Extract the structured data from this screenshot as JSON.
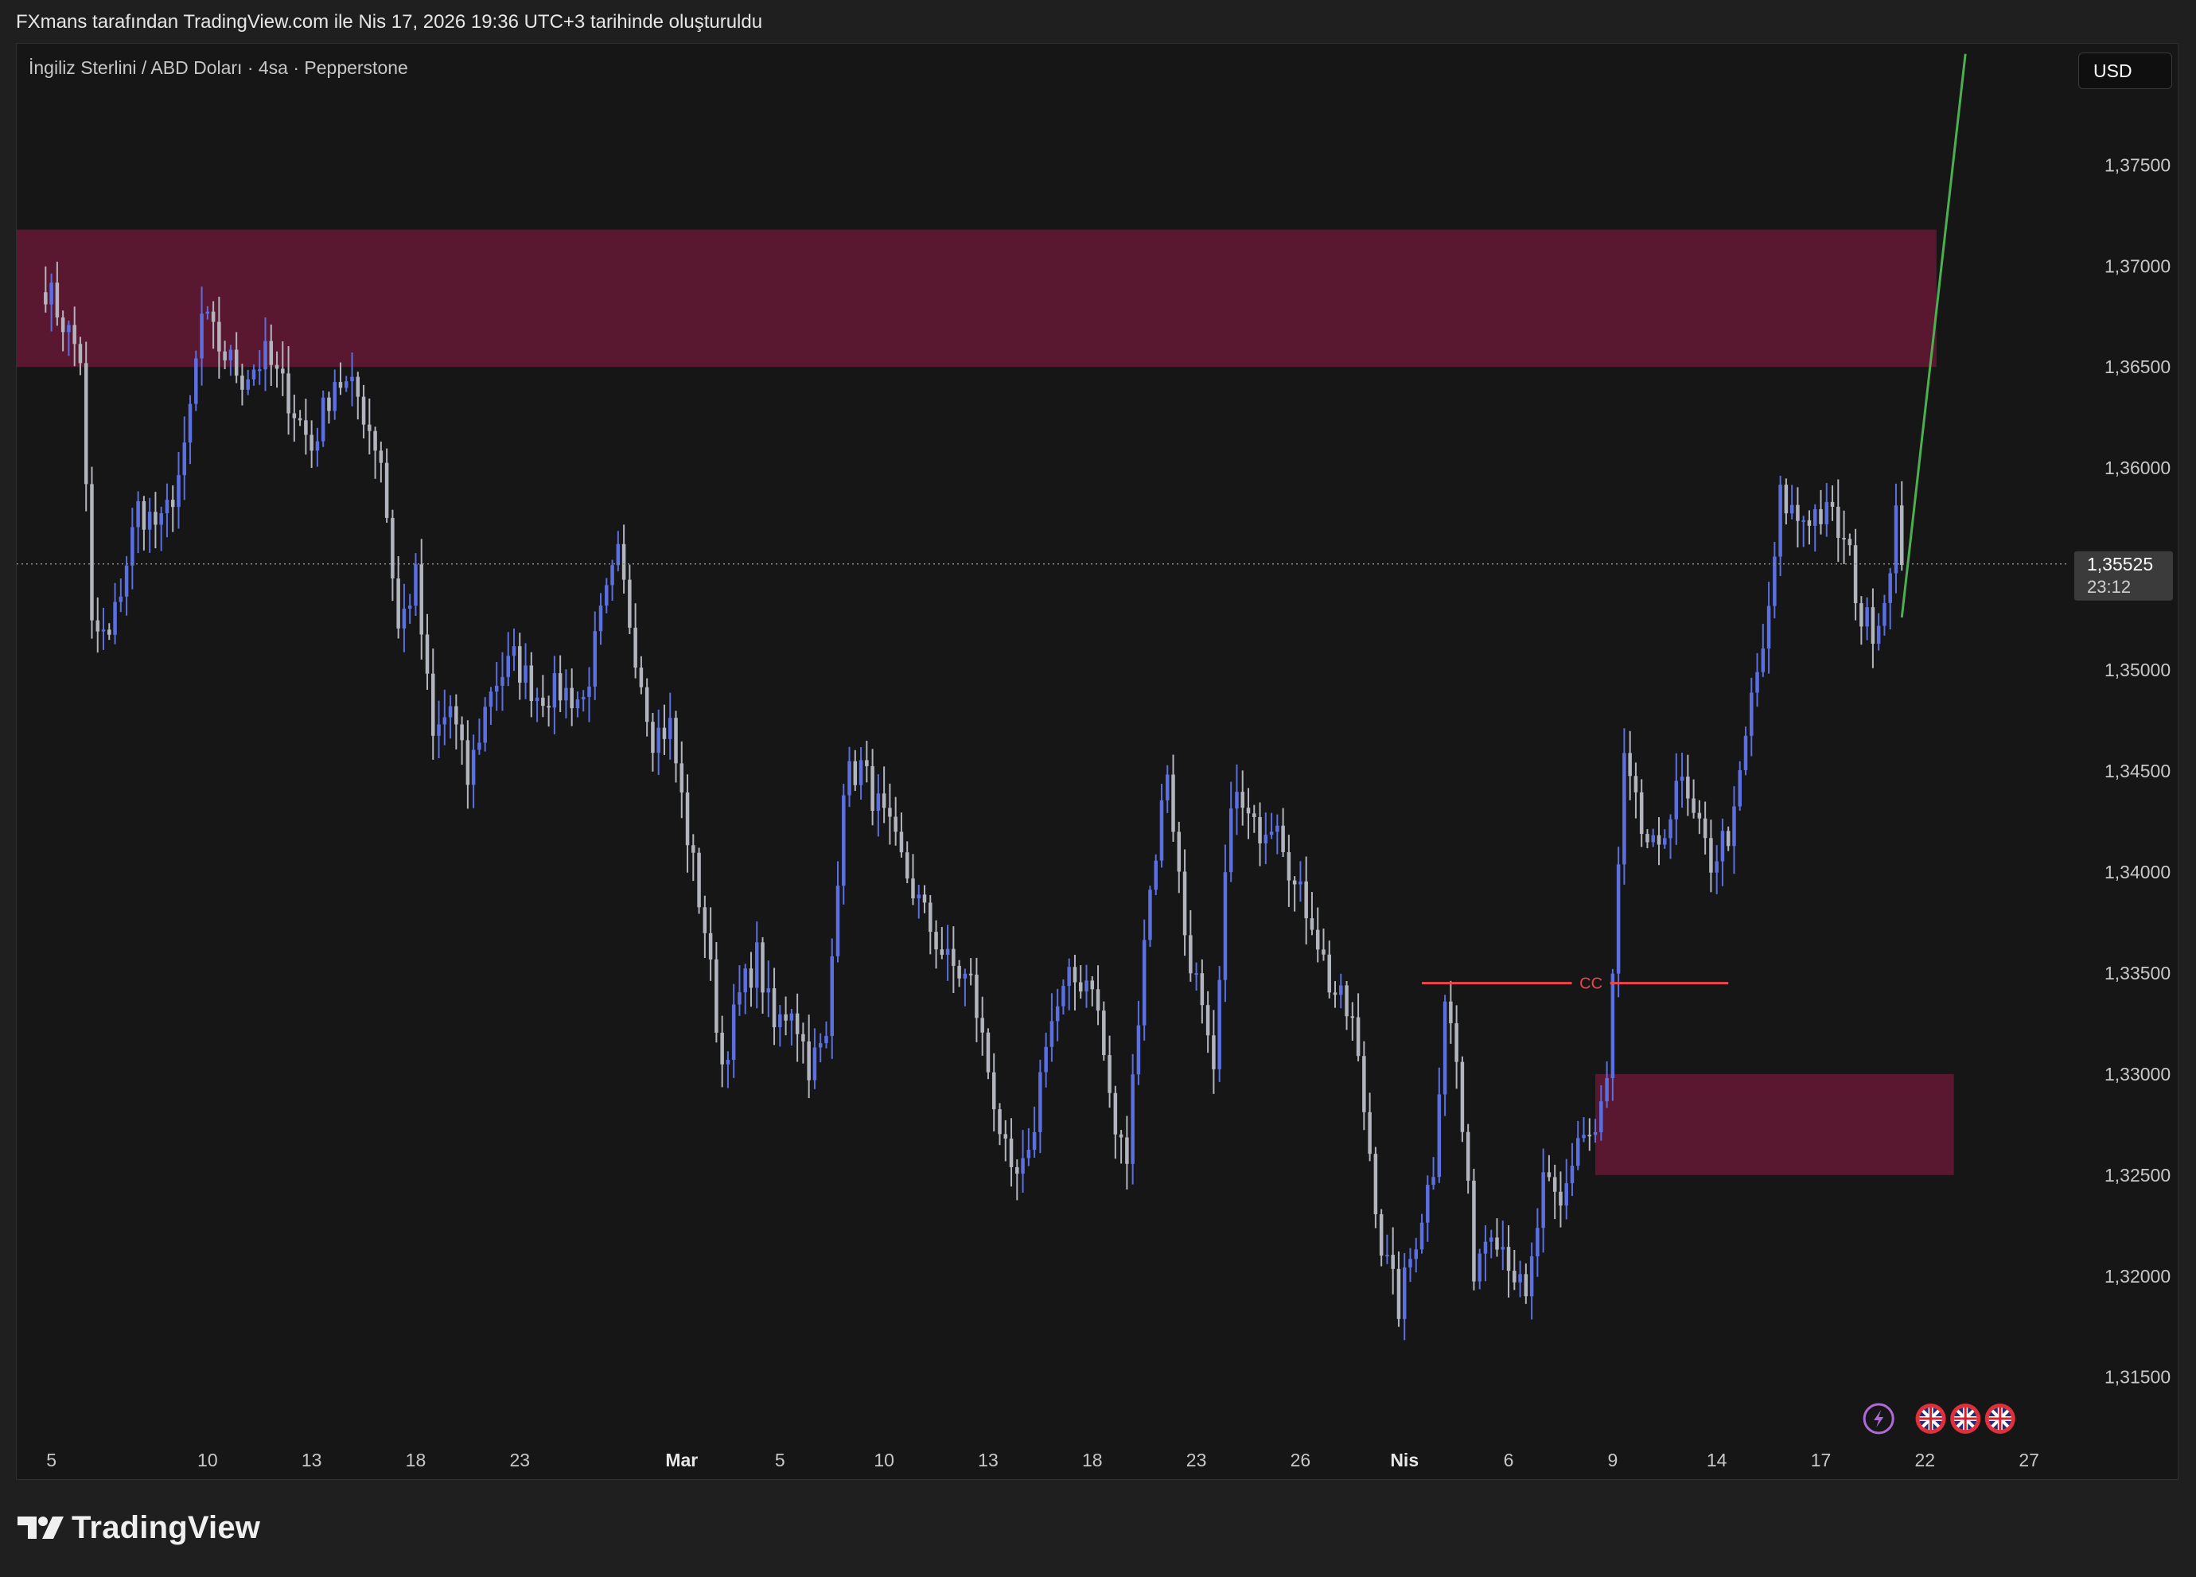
{
  "caption": "FXmans tarafından TradingView.com ile Nis 17, 2026 19:36 UTC+3 tarihinde oluşturuldu",
  "symbol_title": "İngiliz Sterlini / ABD Doları · 4sa · Pepperstone",
  "currency_button": "USD",
  "brand": {
    "name": "TradingView",
    "icon": "tradingview-logo-icon"
  },
  "colors": {
    "background": "#161616",
    "candle_up": "#5b6fe0",
    "candle_down": "#b2b5be",
    "supply_zone": "#5a1830",
    "demand_zone": "#5a1830",
    "projection_line": "#4caf50",
    "cc_line": "#f0444b",
    "price_label_bg": "#3b3b3b",
    "event_lightning": "#b06ad8",
    "event_flag": "#e0303a"
  },
  "chart_data": {
    "type": "candlestick",
    "title": "",
    "xlabel": "",
    "ylabel": "",
    "timeframe": "4sa",
    "ylim": [
      1.3105,
      1.381
    ],
    "y_ticks": [
      "1,37500",
      "1,37000",
      "1,36500",
      "1,36000",
      "1,35000",
      "1,34500",
      "1,34000",
      "1,33500",
      "1,33000",
      "1,32500",
      "1,32000",
      "1,31500"
    ],
    "y_tick_values": [
      1.375,
      1.37,
      1.365,
      1.36,
      1.35,
      1.345,
      1.34,
      1.335,
      1.33,
      1.325,
      1.32,
      1.315
    ],
    "x_ticks": [
      {
        "label": "5",
        "bar": 1,
        "major": false
      },
      {
        "label": "10",
        "bar": 28,
        "major": false
      },
      {
        "label": "13",
        "bar": 46,
        "major": false
      },
      {
        "label": "18",
        "bar": 64,
        "major": false
      },
      {
        "label": "23",
        "bar": 82,
        "major": false
      },
      {
        "label": "Mar",
        "bar": 110,
        "major": true
      },
      {
        "label": "5",
        "bar": 127,
        "major": false
      },
      {
        "label": "10",
        "bar": 145,
        "major": false
      },
      {
        "label": "13",
        "bar": 163,
        "major": false
      },
      {
        "label": "18",
        "bar": 181,
        "major": false
      },
      {
        "label": "23",
        "bar": 199,
        "major": false
      },
      {
        "label": "26",
        "bar": 217,
        "major": false
      },
      {
        "label": "Nis",
        "bar": 235,
        "major": true
      },
      {
        "label": "6",
        "bar": 253,
        "major": false
      },
      {
        "label": "9",
        "bar": 271,
        "major": false
      },
      {
        "label": "14",
        "bar": 289,
        "major": false
      },
      {
        "label": "17",
        "bar": 307,
        "major": false
      },
      {
        "label": "22",
        "bar": 325,
        "major": false
      },
      {
        "label": "27",
        "bar": 343,
        "major": false
      }
    ],
    "x_range_bars": [
      -5,
      350
    ],
    "last_price": {
      "value": 1.35525,
      "label": "1,35525",
      "countdown": "23:12"
    },
    "zones": [
      {
        "name": "supply-zone",
        "bar_from": -5,
        "bar_to": 327,
        "price_from": 1.365,
        "price_to": 1.3718
      },
      {
        "name": "demand-zone",
        "bar_from": 268,
        "bar_to": 330,
        "price_from": 1.325,
        "price_to": 1.33
      }
    ],
    "cc_level": {
      "label": "CC",
      "price": 1.3345,
      "bar_from": 238,
      "bar_to": 291
    },
    "projection_line": {
      "from": {
        "bar": 321,
        "price": 1.3526
      },
      "to": {
        "bar": 332,
        "price": 1.3805
      }
    },
    "events": [
      {
        "type": "lightning",
        "bar": 317
      },
      {
        "type": "flag-uk",
        "bar": 326
      },
      {
        "type": "flag-uk",
        "bar": 332
      },
      {
        "type": "flag-uk",
        "bar": 338
      }
    ],
    "anchors": [
      [
        0,
        1.369
      ],
      [
        6,
        1.3655
      ],
      [
        8,
        1.352
      ],
      [
        11,
        1.3515
      ],
      [
        16,
        1.358
      ],
      [
        20,
        1.357
      ],
      [
        24,
        1.3605
      ],
      [
        27,
        1.3675
      ],
      [
        30,
        1.366
      ],
      [
        34,
        1.3645
      ],
      [
        38,
        1.3655
      ],
      [
        42,
        1.3635
      ],
      [
        46,
        1.361
      ],
      [
        50,
        1.3645
      ],
      [
        54,
        1.3635
      ],
      [
        58,
        1.3605
      ],
      [
        61,
        1.352
      ],
      [
        64,
        1.3545
      ],
      [
        67,
        1.3465
      ],
      [
        70,
        1.3482
      ],
      [
        73,
        1.3445
      ],
      [
        77,
        1.3492
      ],
      [
        81,
        1.3505
      ],
      [
        85,
        1.3488
      ],
      [
        89,
        1.349
      ],
      [
        93,
        1.3485
      ],
      [
        96,
        1.3525
      ],
      [
        99,
        1.3555
      ],
      [
        102,
        1.351
      ],
      [
        105,
        1.3468
      ],
      [
        108,
        1.3472
      ],
      [
        111,
        1.3418
      ],
      [
        114,
        1.3372
      ],
      [
        117,
        1.3305
      ],
      [
        120,
        1.3338
      ],
      [
        123,
        1.3358
      ],
      [
        126,
        1.3322
      ],
      [
        129,
        1.3335
      ],
      [
        132,
        1.3305
      ],
      [
        135,
        1.3315
      ],
      [
        138,
        1.3445
      ],
      [
        141,
        1.3452
      ],
      [
        144,
        1.3432
      ],
      [
        148,
        1.3405
      ],
      [
        152,
        1.3378
      ],
      [
        156,
        1.3355
      ],
      [
        160,
        1.3345
      ],
      [
        164,
        1.3288
      ],
      [
        167,
        1.3245
      ],
      [
        170,
        1.3255
      ],
      [
        173,
        1.332
      ],
      [
        177,
        1.3345
      ],
      [
        181,
        1.3348
      ],
      [
        185,
        1.327
      ],
      [
        187,
        1.3258
      ],
      [
        190,
        1.337
      ],
      [
        194,
        1.3452
      ],
      [
        197,
        1.337
      ],
      [
        199,
        1.3345
      ],
      [
        202,
        1.3295
      ],
      [
        205,
        1.344
      ],
      [
        209,
        1.342
      ],
      [
        213,
        1.343
      ],
      [
        216,
        1.3392
      ],
      [
        219,
        1.3378
      ],
      [
        222,
        1.3345
      ],
      [
        226,
        1.3325
      ],
      [
        229,
        1.3262
      ],
      [
        231,
        1.3215
      ],
      [
        234,
        1.3185
      ],
      [
        237,
        1.322
      ],
      [
        240,
        1.3255
      ],
      [
        242,
        1.334
      ],
      [
        244,
        1.3305
      ],
      [
        247,
        1.3205
      ],
      [
        250,
        1.3228
      ],
      [
        253,
        1.321
      ],
      [
        256,
        1.3185
      ],
      [
        259,
        1.3245
      ],
      [
        262,
        1.3232
      ],
      [
        265,
        1.327
      ],
      [
        268,
        1.327
      ],
      [
        270,
        1.3295
      ],
      [
        273,
        1.3452
      ],
      [
        276,
        1.342
      ],
      [
        279,
        1.3405
      ],
      [
        282,
        1.3448
      ],
      [
        285,
        1.3425
      ],
      [
        288,
        1.3405
      ],
      [
        292,
        1.3425
      ],
      [
        295,
        1.3485
      ],
      [
        298,
        1.3525
      ],
      [
        300,
        1.3585
      ],
      [
        303,
        1.3575
      ],
      [
        306,
        1.3578
      ],
      [
        309,
        1.3575
      ],
      [
        312,
        1.3555
      ],
      [
        314,
        1.3525
      ],
      [
        316,
        1.3522
      ],
      [
        318,
        1.3535
      ],
      [
        320,
        1.3578
      ],
      [
        321,
        1.3552
      ]
    ]
  }
}
